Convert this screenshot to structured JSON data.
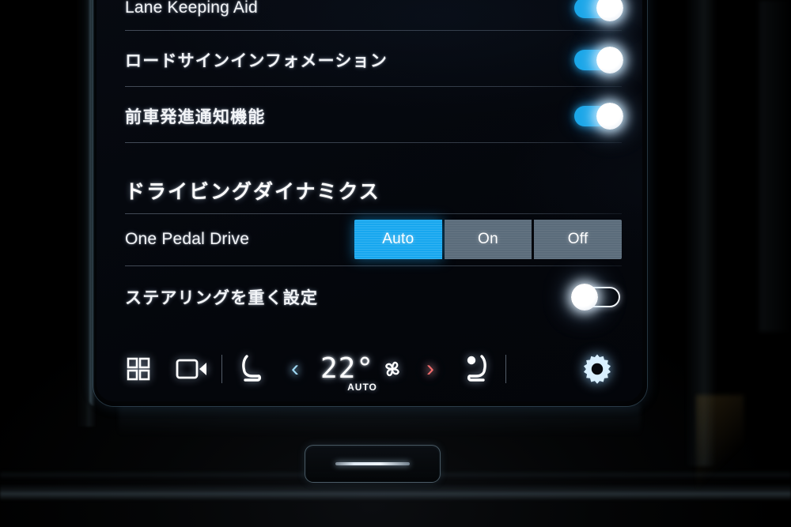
{
  "screen": {
    "list_items": [
      {
        "label": "Lane Keeping Aid",
        "lang": "en",
        "toggle": "on"
      },
      {
        "label": "ロードサインインフォメーション",
        "lang": "jp",
        "toggle": "on"
      },
      {
        "label": "前車発進通知機能",
        "lang": "jp",
        "toggle": "on"
      }
    ],
    "section": {
      "title": "ドライビングダイナミクス",
      "one_pedal": {
        "label": "One Pedal Drive",
        "options": [
          "Auto",
          "On",
          "Off"
        ],
        "selected": "Auto"
      },
      "steering": {
        "label": "ステアリングを重く設定",
        "toggle": "off"
      }
    }
  },
  "toolbar": {
    "apps_label": "apps-grid-icon",
    "camera_label": "camera-icon",
    "driver_seat_label": "driver-seat-icon",
    "decrease_label": "‹",
    "temperature": "22°",
    "auto_label": "AUTO",
    "increase_label": "›",
    "passenger_seat_label": "passenger-seat-icon",
    "settings_label": "gear-icon"
  },
  "hardware": {
    "home_button_label": "home-hard-button"
  },
  "colors": {
    "accent_blue": "#17a7ef",
    "segment_gray": "#5b6c7b",
    "knob_white": "#ffffff",
    "chevron_left": "#9fd8f2",
    "chevron_right": "#f26b6b",
    "gear_blue": "#cfeaff"
  }
}
